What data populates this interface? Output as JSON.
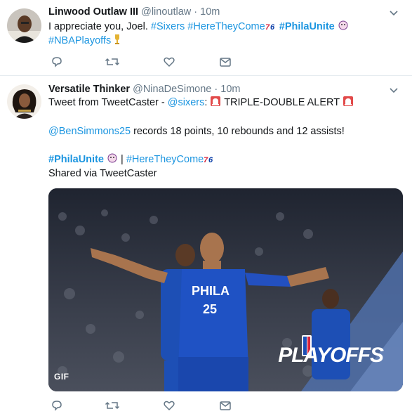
{
  "tweets": [
    {
      "name": "Linwood Outlaw III",
      "handle": "@linoutlaw",
      "sep": "·",
      "time": "10m",
      "line1": {
        "t1": "I appreciate you, Joel. ",
        "h1": "#Sixers",
        "h2": "#HereTheyCome",
        "h3": "#PhilaUnite",
        "h4": "#NBAPlayoffs"
      }
    },
    {
      "name": "Versatile Thinker",
      "handle": "@NinaDeSimone",
      "sep": "·",
      "time": "10m",
      "l1a": "Tweet from TweetCaster - ",
      "l1m": "@sixers",
      "l1b": ": ",
      "l1c": " TRIPLE-DOUBLE ALERT ",
      "l2m": "@BenSimmons25",
      "l2t": " records 18 points, 10 rebounds and 12 assists!",
      "l3h1": "#PhilaUnite",
      "l3sep": " | ",
      "l3h2": "#HereTheyCome",
      "l4": "Shared via TweetCaster",
      "media": {
        "badge": "GIF",
        "overlay": "PLAYOFFS",
        "jersey_text": "PHILA",
        "jersey_number": "25"
      }
    }
  ],
  "icons": [
    "reply-icon",
    "retweet-icon",
    "like-icon",
    "message-icon",
    "chevron-down-icon"
  ],
  "colors": {
    "link": "#1b95e0",
    "secondary": "#657786",
    "action": "#657786",
    "sixers_blue": "#0a3ea8",
    "sixers_red": "#d8243c"
  }
}
